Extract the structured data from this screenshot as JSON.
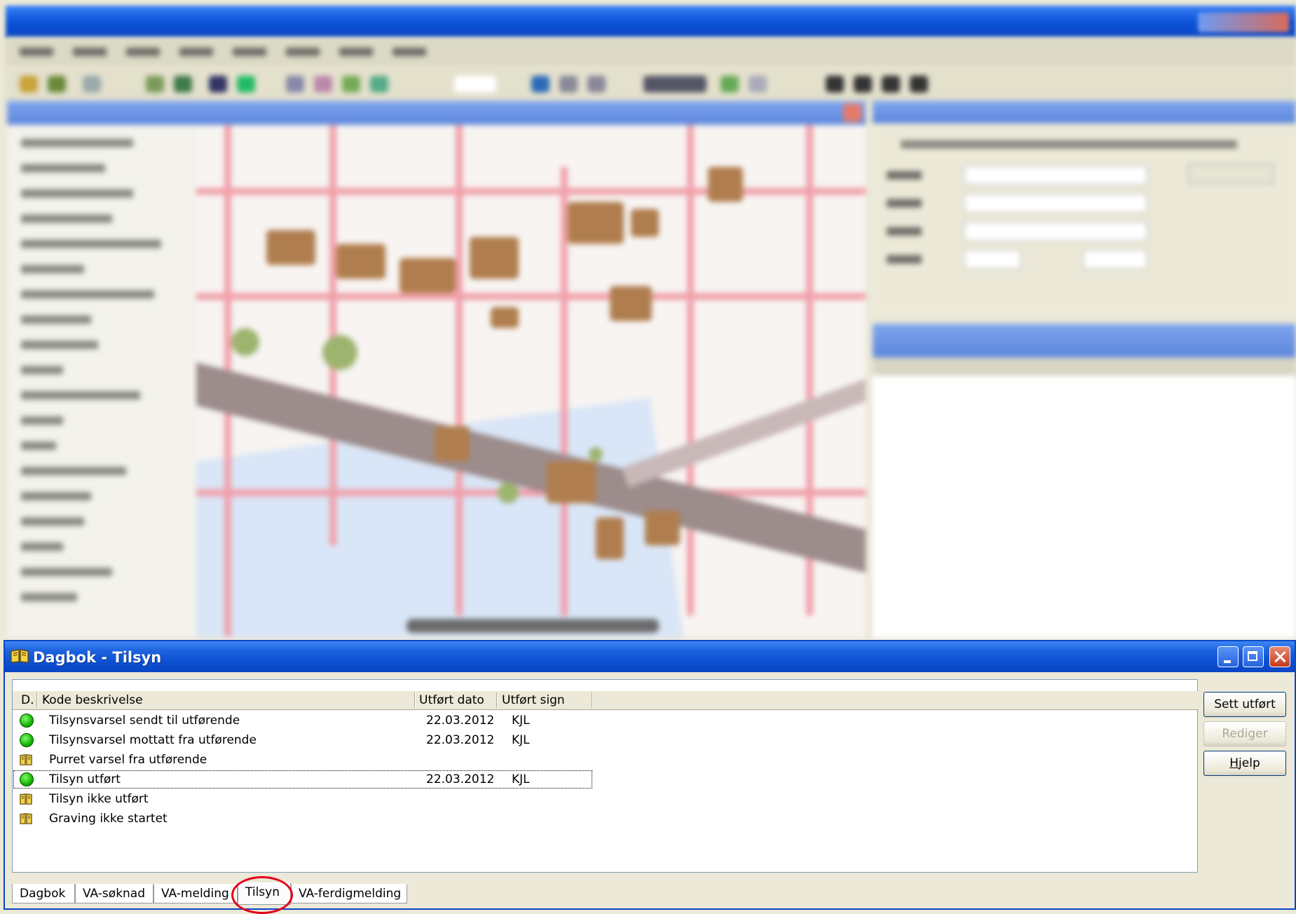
{
  "window": {
    "title": "Dagbok - Tilsyn",
    "icon": "book-icon"
  },
  "list": {
    "columns": [
      "D.",
      "Kode beskrivelse",
      "Utført dato",
      "Utført sign"
    ],
    "rows": [
      {
        "status_icon": "green-circle-icon",
        "kode": "Tilsynsvarsel sendt til utførende",
        "dato": "22.03.2012",
        "sign": "KJL"
      },
      {
        "status_icon": "green-circle-icon",
        "kode": "Tilsynsvarsel mottatt fra utførende",
        "dato": "22.03.2012",
        "sign": "KJL"
      },
      {
        "status_icon": "book-icon",
        "kode": "Purret varsel fra utførende",
        "dato": "",
        "sign": ""
      },
      {
        "status_icon": "green-circle-icon",
        "kode": "Tilsyn utført",
        "dato": "22.03.2012",
        "sign": "KJL"
      },
      {
        "status_icon": "book-icon",
        "kode": "Tilsyn ikke utført",
        "dato": "",
        "sign": ""
      },
      {
        "status_icon": "book-icon",
        "kode": "Graving ikke startet",
        "dato": "",
        "sign": ""
      }
    ]
  },
  "buttons": {
    "sett_utfort": "Sett utført",
    "rediger": "Rediger",
    "hjelp_accel": "H",
    "hjelp_rest": "jelp"
  },
  "tabs": [
    "Dagbok",
    "VA-søknad",
    "VA-melding",
    "Tilsyn",
    "VA-ferdigmelding"
  ],
  "active_tab": "Tilsyn",
  "colors": {
    "titlebar": "#0a46c4",
    "highlight_circle": "#e4001b",
    "status_green": "#16b400"
  }
}
